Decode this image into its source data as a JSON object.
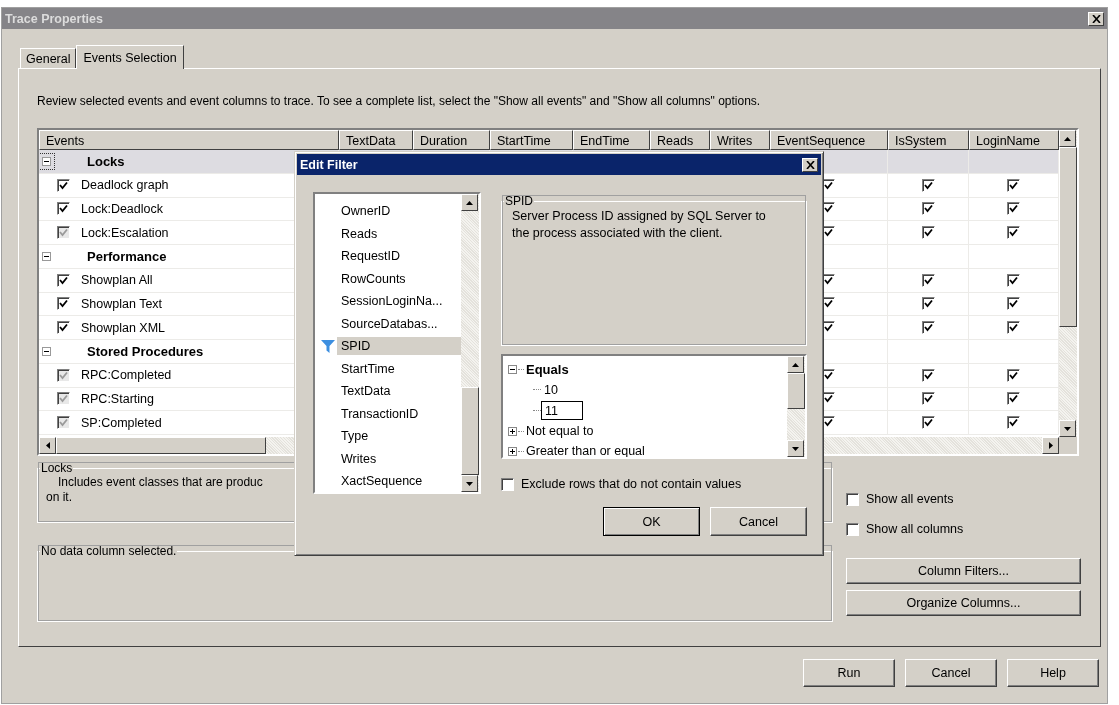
{
  "window": {
    "title": "Trace Properties"
  },
  "tabs": [
    {
      "label": "General",
      "selected": false
    },
    {
      "label": "Events Selection",
      "selected": true
    }
  ],
  "instructions": "Review selected events and event columns to trace. To see a complete list, select the \"Show all events\" and \"Show all columns\" options.",
  "grid": {
    "columns": [
      "Events",
      "TextData",
      "Duration",
      "StartTime",
      "EndTime",
      "Reads",
      "Writes",
      "EventSequence",
      "IsSystem",
      "LoginName"
    ],
    "rows": [
      {
        "kind": "group",
        "label": "Locks",
        "expanded": true,
        "selected": true
      },
      {
        "kind": "event",
        "label": "Deadlock graph",
        "checked": true,
        "disabled": false,
        "checks": [
          true,
          true,
          true
        ]
      },
      {
        "kind": "event",
        "label": "Lock:Deadlock",
        "checked": true,
        "disabled": false,
        "checks": [
          true,
          true,
          true
        ]
      },
      {
        "kind": "event",
        "label": "Lock:Escalation",
        "checked": true,
        "disabled": true,
        "checks": [
          true,
          true,
          true
        ]
      },
      {
        "kind": "group",
        "label": "Performance",
        "expanded": true,
        "selected": false
      },
      {
        "kind": "event",
        "label": "Showplan All",
        "checked": true,
        "disabled": false,
        "checks": [
          true,
          true,
          true
        ]
      },
      {
        "kind": "event",
        "label": "Showplan Text",
        "checked": true,
        "disabled": false,
        "checks": [
          true,
          true,
          true
        ]
      },
      {
        "kind": "event",
        "label": "Showplan XML",
        "checked": true,
        "disabled": false,
        "checks": [
          true,
          true,
          true
        ]
      },
      {
        "kind": "group",
        "label": "Stored Procedures",
        "expanded": true,
        "selected": false
      },
      {
        "kind": "event",
        "label": "RPC:Completed",
        "checked": true,
        "disabled": true,
        "checks": [
          true,
          true,
          true
        ]
      },
      {
        "kind": "event",
        "label": "RPC:Starting",
        "checked": true,
        "disabled": true,
        "checks": [
          true,
          true,
          true
        ]
      },
      {
        "kind": "event",
        "label": "SP:Completed",
        "checked": true,
        "disabled": true,
        "checks": [
          true,
          true,
          true
        ]
      }
    ]
  },
  "event_info": {
    "title": "Locks",
    "lines": [
      "Includes event classes that are produc",
      "on it."
    ]
  },
  "column_info": {
    "title": "No data column selected."
  },
  "options": [
    {
      "label": "Show all events",
      "checked": false
    },
    {
      "label": "Show all columns",
      "checked": false
    }
  ],
  "side_buttons": [
    "Column Filters...",
    "Organize Columns..."
  ],
  "footer_buttons": [
    "Run",
    "Cancel",
    "Help"
  ],
  "dialog": {
    "title": "Edit Filter",
    "columns": [
      {
        "label": "OwnerID",
        "selected": false,
        "filtered": false
      },
      {
        "label": "Reads",
        "selected": false,
        "filtered": false
      },
      {
        "label": "RequestID",
        "selected": false,
        "filtered": false
      },
      {
        "label": "RowCounts",
        "selected": false,
        "filtered": false
      },
      {
        "label": "SessionLoginNa...",
        "selected": false,
        "filtered": false
      },
      {
        "label": "SourceDatabas...",
        "selected": false,
        "filtered": false
      },
      {
        "label": "SPID",
        "selected": true,
        "filtered": true
      },
      {
        "label": "StartTime",
        "selected": false,
        "filtered": false
      },
      {
        "label": "TextData",
        "selected": false,
        "filtered": false
      },
      {
        "label": "TransactionID",
        "selected": false,
        "filtered": false
      },
      {
        "label": "Type",
        "selected": false,
        "filtered": false
      },
      {
        "label": "Writes",
        "selected": false,
        "filtered": false
      },
      {
        "label": "XactSequence",
        "selected": false,
        "filtered": false
      }
    ],
    "detail": {
      "title": "SPID",
      "description": "Server Process ID assigned by SQL Server to the process associated with the client."
    },
    "operators": [
      {
        "label": "Equals",
        "expanded": true,
        "children": [
          {
            "value": "10",
            "editing": false
          },
          {
            "value": "11",
            "editing": true
          }
        ]
      },
      {
        "label": "Not equal to",
        "expanded": false
      },
      {
        "label": "Greater than or equal",
        "expanded": false
      }
    ],
    "exclude": {
      "label": "Exclude rows that do not contain values",
      "checked": false
    },
    "buttons": [
      "OK",
      "Cancel"
    ]
  }
}
